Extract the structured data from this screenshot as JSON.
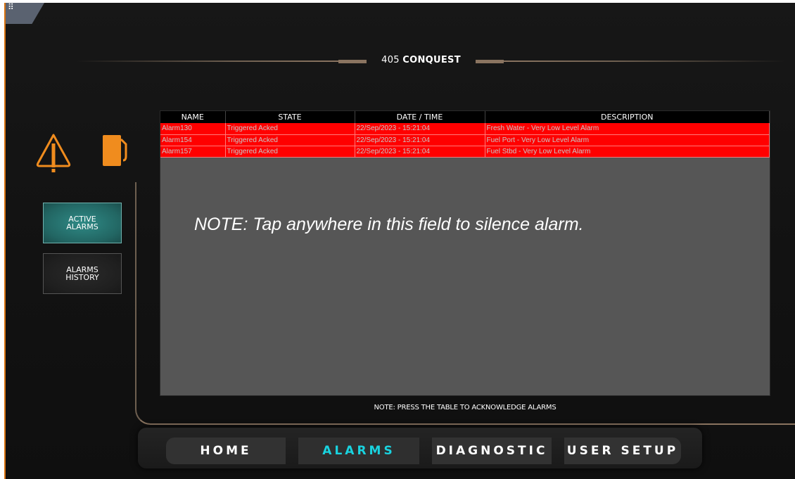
{
  "corner": {
    "glyph": "⠿"
  },
  "header": {
    "title_prefix": "405 ",
    "title_bold": "CONQUEST"
  },
  "sidebar": {
    "active_alarms_label": "ACTIVE\nALARMS",
    "alarms_history_label": "ALARMS\nHISTORY"
  },
  "table": {
    "columns": [
      "NAME",
      "STATE",
      "DATE / TIME",
      "DESCRIPTION"
    ],
    "rows": [
      {
        "name": "Alarm130",
        "state": "Triggered Acked",
        "datetime": "22/Sep/2023 - 15:21:04",
        "description": "Fresh Water - Very Low Level Alarm"
      },
      {
        "name": "Alarm154",
        "state": "Triggered Acked",
        "datetime": "22/Sep/2023 - 15:21:04",
        "description": "Fuel Port - Very Low Level Alarm"
      },
      {
        "name": "Alarm157",
        "state": "Triggered Acked",
        "datetime": "22/Sep/2023 - 15:21:04",
        "description": "Fuel Stbd - Very Low Level Alarm"
      }
    ],
    "row_color": "#ff0000"
  },
  "notes": {
    "silence": "NOTE: Tap anywhere in this field to silence alarm.",
    "acknowledge": "NOTE: PRESS THE TABLE TO ACKNOWLEDGE ALARMS"
  },
  "nav": {
    "home": "HOME",
    "alarms": "ALARMS",
    "diagnostic": "DIAGNOSTIC",
    "user_setup": "USER SETUP",
    "active_color": "#19d3df"
  },
  "icons": {
    "warning": "warning-triangle-icon",
    "fuel": "fuel-pump-icon"
  },
  "colors": {
    "accent_orange": "#f08c1e",
    "teal": "#2f8a86"
  }
}
